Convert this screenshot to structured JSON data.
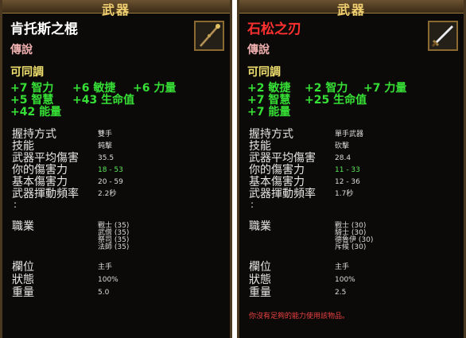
{
  "left": {
    "header": "武器",
    "name": "肯托斯之棍",
    "name_color": "#ffffff",
    "rarity": "傳說",
    "tradable": "可同調",
    "icon": "staff-icon",
    "stats": [
      [
        "+7 智力",
        "+6 敏捷",
        "+6 力量"
      ],
      [
        "+5 智慧",
        "+43 生命值"
      ],
      [
        "+42 能量"
      ]
    ],
    "info": [
      {
        "label": "握持方式",
        "value": "雙手"
      },
      {
        "label": "技能",
        "value": "鈍擊"
      },
      {
        "label": "武器平均傷害",
        "value": "35.5"
      },
      {
        "label": "你的傷害力",
        "value": "18 - 53"
      },
      {
        "label": "基本傷害力",
        "value": "20 - 59"
      },
      {
        "label": "武器揮動頻率",
        "value": "2.2秒"
      }
    ],
    "colon": ":",
    "class_label": "職業",
    "classes": [
      "戰士 (35)",
      "武僧 (35)",
      "祭司 (35)",
      "法師 (35)"
    ],
    "extra": [
      {
        "label": "欄位",
        "value": "主手"
      },
      {
        "label": "狀態",
        "value": "100%"
      },
      {
        "label": "重量",
        "value": "5.0"
      }
    ]
  },
  "right": {
    "header": "武器",
    "name": "石松之刃",
    "name_color": "#ff3030",
    "rarity": "傳說",
    "tradable": "可同調",
    "icon": "sword-icon",
    "stats": [
      [
        "+2 敏捷",
        "+2 智力",
        "+7 力量"
      ],
      [
        "+7 智慧",
        "+25 生命值"
      ],
      [
        "+7 能量"
      ]
    ],
    "info": [
      {
        "label": "握持方式",
        "value": "單手武器"
      },
      {
        "label": "技能",
        "value": "砍擊"
      },
      {
        "label": "武器平均傷害",
        "value": "28.4"
      },
      {
        "label": "你的傷害力",
        "value": "11 - 33"
      },
      {
        "label": "基本傷害力",
        "value": "12 - 36"
      },
      {
        "label": "武器揮動頻率",
        "value": "1.7秒"
      }
    ],
    "colon": ":",
    "class_label": "職業",
    "classes": [
      "戰士 (30)",
      "騎士 (30)",
      "德魯伊 (30)",
      "斥候 (30)"
    ],
    "extra": [
      {
        "label": "欄位",
        "value": "主手"
      },
      {
        "label": "狀態",
        "value": "100%"
      },
      {
        "label": "重量",
        "value": "2.5"
      }
    ],
    "warning": "你沒有足夠的能力使用該物品。"
  }
}
